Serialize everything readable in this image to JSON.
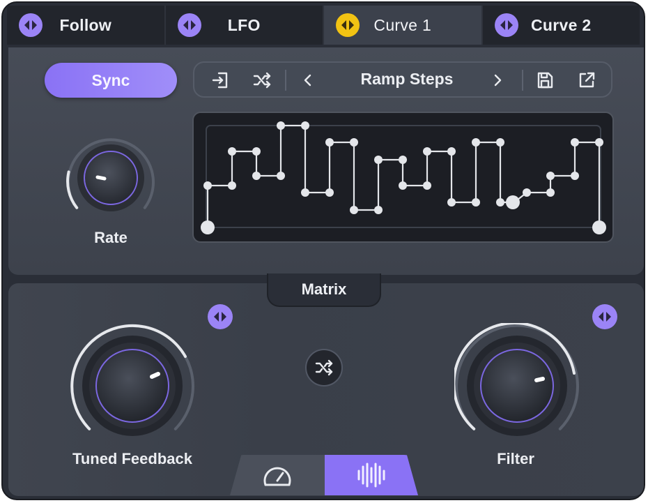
{
  "tabs": [
    {
      "label": "Follow",
      "active": false,
      "icon": "mod-arrows-icon",
      "icon_color": "#9b84f6"
    },
    {
      "label": "LFO",
      "active": false,
      "icon": "mod-arrows-icon",
      "icon_color": "#9b84f6"
    },
    {
      "label": "Curve 1",
      "active": true,
      "icon": "mod-arrows-icon",
      "icon_color": "#f2c313"
    },
    {
      "label": "Curve 2",
      "active": false,
      "icon": "mod-arrows-icon",
      "icon_color": "#9b84f6"
    }
  ],
  "sync": {
    "label": "Sync",
    "on": true
  },
  "toolbar": {
    "preset_name": "Ramp Steps",
    "icons": [
      "import-icon",
      "shuffle-icon",
      "chevron-left-icon",
      "chevron-right-icon",
      "save-icon",
      "export-icon"
    ]
  },
  "rate": {
    "label": "Rate",
    "value": 0.08
  },
  "matrix": {
    "title": "Matrix"
  },
  "knobs": {
    "tuned_feedback": {
      "label": "Tuned Feedback",
      "value": 0.92
    },
    "filter": {
      "label": "Filter",
      "value": 0.92
    }
  },
  "view_tabs": [
    {
      "icon": "gauge-icon",
      "active": false
    },
    {
      "icon": "waveform-icon",
      "active": true
    }
  ],
  "colors": {
    "accent": "#8a72f5",
    "accent_light": "#9b84f6",
    "active_tab_icon": "#f2c313"
  }
}
